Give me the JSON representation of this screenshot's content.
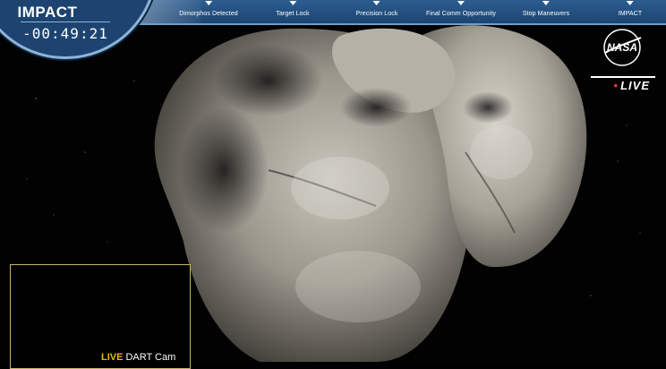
{
  "countdown": {
    "title": "IMPACT",
    "time": "-00:49:21"
  },
  "timeline": {
    "milestones": [
      {
        "label": "Dimorphos Detected"
      },
      {
        "label": "Target Lock"
      },
      {
        "label": "Precision Lock"
      },
      {
        "label": "Final Comm Opportunity"
      },
      {
        "label": "Stop Maneuvers"
      },
      {
        "label": "IMPACT"
      }
    ]
  },
  "branding": {
    "logo_text": "NASA",
    "live": "LIVE"
  },
  "pip": {
    "live": "LIVE",
    "camera": "DART Cam"
  },
  "colors": {
    "timeline": "#1b4472",
    "dial": "#1d4470",
    "live_dot": "#e23b2c",
    "pip_live": "#f2b01e",
    "pip_border": "#c9b56c"
  },
  "icons": [
    "nasa-logo",
    "timeline-arrow-icon"
  ]
}
